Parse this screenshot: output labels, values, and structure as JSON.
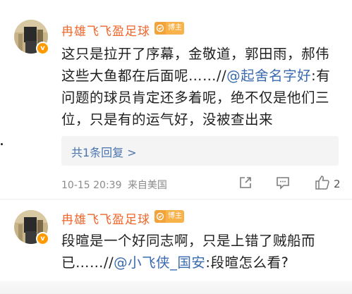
{
  "comments": [
    {
      "username": "冉雄飞飞盈足球",
      "badge": "博主",
      "verified_mark": "v",
      "lines": [
        [
          "这只是拉开了序幕，金敬道，郭田雨，郝伟"
        ],
        [
          "这些大鱼都在后面呢……//",
          "@起舍名字好",
          ":有"
        ],
        [
          "问题的球员肯定还多着呢，绝不仅是他们三"
        ],
        [
          "位，只是有的运气好，没被查出来"
        ]
      ],
      "reply_link": "共1条回复 >",
      "time": "10-15 20:39",
      "location": "来自美国",
      "likes": "2",
      "icons": [
        "share-icon",
        "comment-icon",
        "like-icon"
      ]
    },
    {
      "username": "冉雄飞飞盈足球",
      "badge": "博主",
      "verified_mark": "v",
      "lines": [
        [
          "段暄是一个好同志啊，只是上错了贼船而"
        ],
        [
          "已……//",
          "@小飞侠_国安",
          ":段暄怎么看?"
        ]
      ]
    }
  ],
  "colors": {
    "username": "#f2652b",
    "mention": "#3a6bb0",
    "reply_link": "#4a74b0",
    "meta": "#8a8a8a",
    "badge": "#f7b24a"
  }
}
